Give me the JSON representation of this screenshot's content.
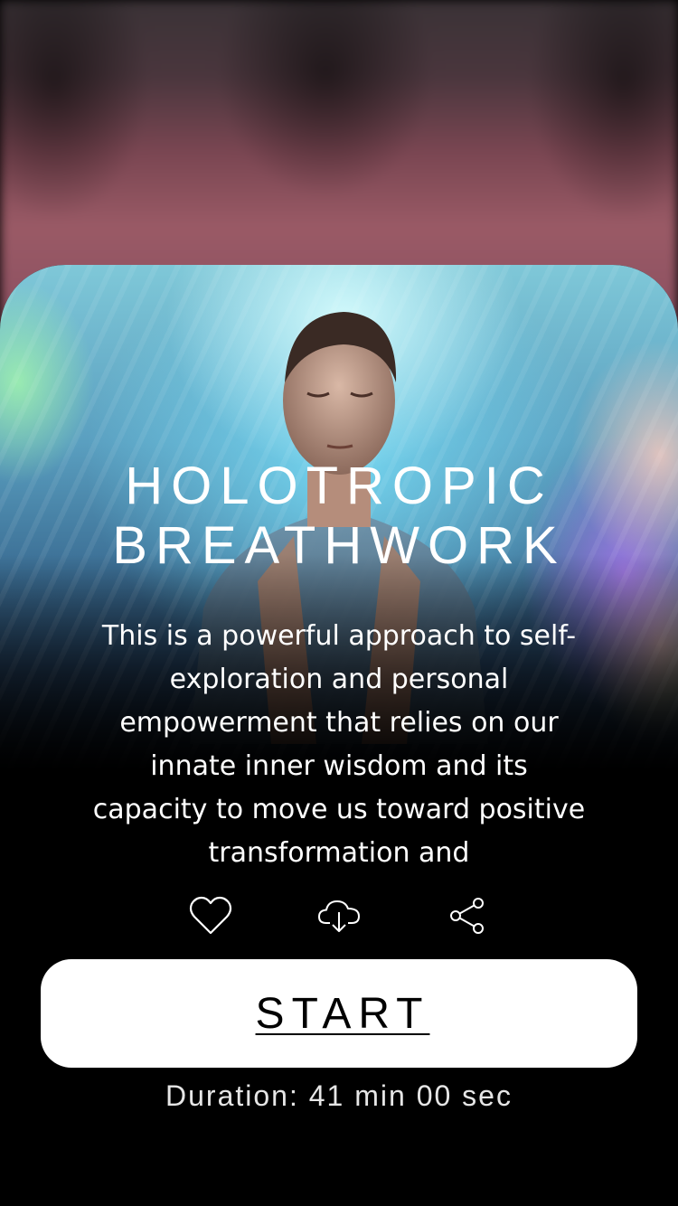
{
  "session": {
    "title_line1": "HOLOTROPIC",
    "title_line2": "BREATHWORK",
    "description": "This is a powerful approach to self-exploration and personal empowerment that relies on our innate inner wisdom and its capacity to move us toward positive transformation and",
    "start_label": "START",
    "duration_label": "Duration:",
    "duration_minutes": "41 min",
    "duration_seconds": "00 sec"
  },
  "actions": [
    {
      "icon": "heart-icon",
      "action": "like"
    },
    {
      "icon": "cloud-download-icon",
      "action": "download"
    },
    {
      "icon": "share-icon",
      "action": "share"
    }
  ],
  "colors": {
    "background": "#000000",
    "button_background": "#FFFFFF",
    "button_text": "#000000",
    "text": "#FFFFFF"
  }
}
